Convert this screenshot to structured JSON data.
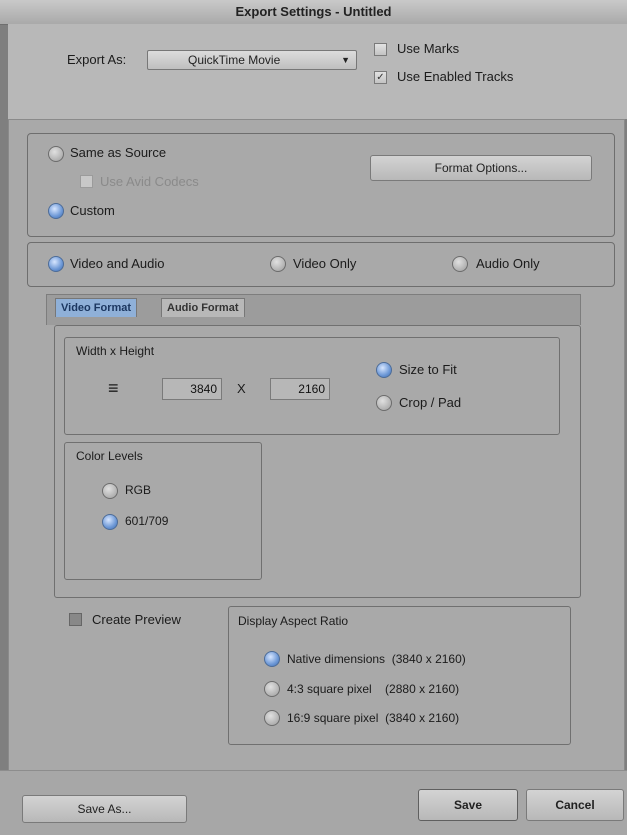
{
  "window": {
    "title": "Export Settings - Untitled"
  },
  "export_as": {
    "label": "Export As:",
    "selected": "QuickTime Movie",
    "use_marks": {
      "label": "Use Marks",
      "checked": false
    },
    "use_enabled_tracks": {
      "label": "Use Enabled Tracks",
      "checked": true
    }
  },
  "source": {
    "same_as_source": {
      "label": "Same as Source",
      "selected": false
    },
    "use_avid_codecs": {
      "label": "Use Avid Codecs",
      "checked": false,
      "enabled": false
    },
    "custom": {
      "label": "Custom",
      "selected": true
    },
    "format_options_label": "Format Options..."
  },
  "tracks": {
    "video_and_audio": {
      "label": "Video and Audio",
      "selected": true
    },
    "video_only": {
      "label": "Video Only",
      "selected": false
    },
    "audio_only": {
      "label": "Audio Only",
      "selected": false
    }
  },
  "tabs": [
    {
      "label": "Video Format",
      "active": true
    },
    {
      "label": "Audio Format",
      "active": false
    }
  ],
  "dimensions": {
    "group_label": "Width x Height",
    "lock_symbol": "≡",
    "width": "3840",
    "separator": "X",
    "height": "2160",
    "size_to_fit": {
      "label": "Size to Fit",
      "selected": true
    },
    "crop_pad": {
      "label": "Crop / Pad",
      "selected": false
    }
  },
  "color_levels": {
    "group_label": "Color Levels",
    "rgb": {
      "label": "RGB",
      "selected": false
    },
    "bt601_709": {
      "label": "601/709",
      "selected": true
    }
  },
  "create_preview": {
    "label": "Create Preview",
    "checked": false
  },
  "aspect_ratio": {
    "group_label": "Display Aspect Ratio",
    "native": {
      "label": "Native dimensions  (3840 x 2160)",
      "selected": true
    },
    "sq43": {
      "label": "4:3 square pixel    (2880 x 2160)",
      "selected": false
    },
    "sq169": {
      "label": "16:9 square pixel  (3840 x 2160)",
      "selected": false
    }
  },
  "footer": {
    "save_as_label": "Save As...",
    "save_label": "Save",
    "cancel_label": "Cancel"
  },
  "colors": {
    "active_radio": "#6d98d6",
    "active_tab": "#8fb0d8",
    "panel_bg": "#a9a9a9"
  }
}
